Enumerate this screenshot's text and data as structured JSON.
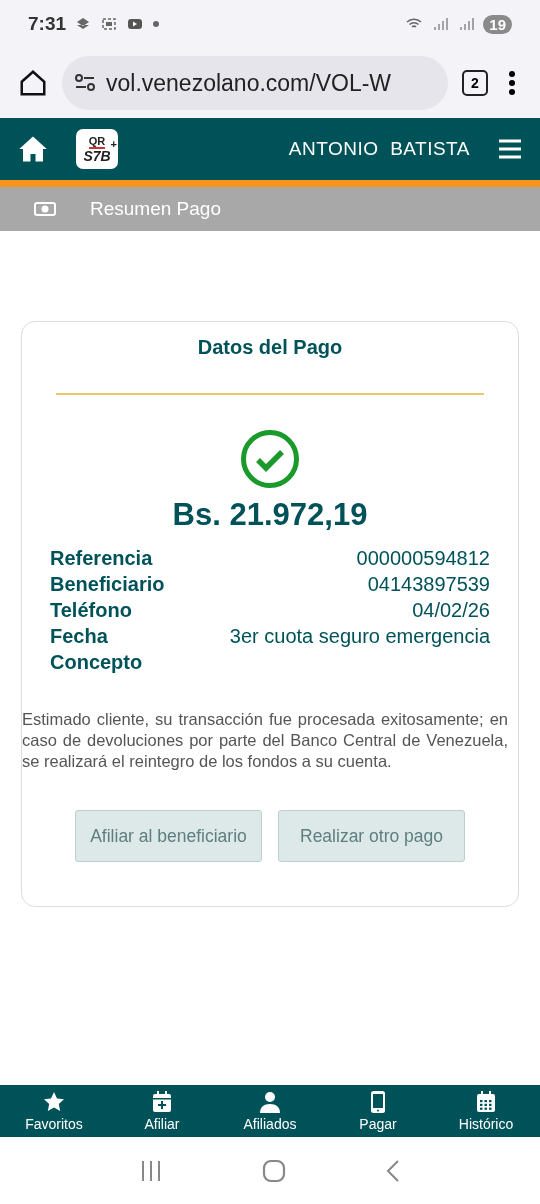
{
  "status_bar": {
    "time": "7:31",
    "battery": "19"
  },
  "browser": {
    "url": "vol.venezolano.com/VOL-W",
    "tab_count": "2"
  },
  "header": {
    "logo_top": "QR",
    "logo_bottom": "S7B",
    "logo_plus": "+",
    "user": "ANTONIO  BATISTA"
  },
  "section_bar": {
    "title": "Resumen Pago"
  },
  "card": {
    "title": "Datos del Pago",
    "amount": "Bs. 21.972,19",
    "labels": [
      "Referencia",
      "Beneficiario",
      "Teléfono",
      "Fecha",
      "Concepto"
    ],
    "values": [
      "000000594812",
      "04143897539",
      "04/02/26",
      "3er cuota seguro emergencia"
    ],
    "message": "Estimado cliente, su transacción fue procesada exitosamente; en caso de devoluciones por parte del Banco Central de Venezuela, se realizará el reintegro de los fondos a su cuenta.",
    "buttons": [
      "Afiliar al beneficiario",
      "Realizar otro pago"
    ]
  },
  "bottom_nav": [
    {
      "kind": "star",
      "label": "Favoritos"
    },
    {
      "kind": "calendar-plus",
      "label": "Afiliar"
    },
    {
      "kind": "person",
      "label": "Afiliados"
    },
    {
      "kind": "phone",
      "label": "Pagar"
    },
    {
      "kind": "calendar",
      "label": "Histórico"
    }
  ]
}
